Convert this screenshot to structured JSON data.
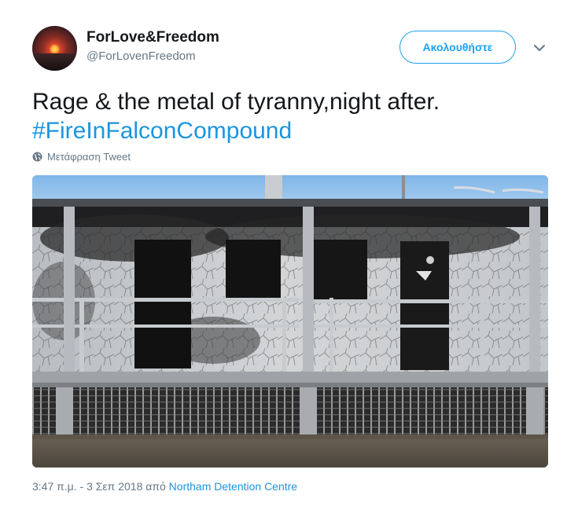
{
  "author": {
    "display_name": "ForLove&Freedom",
    "handle": "@ForLovenFreedom",
    "avatar_icon": "sunset-avatar"
  },
  "follow_button": {
    "label": "Ακολουθήστε"
  },
  "menu": {
    "icon": "chevron-down-icon"
  },
  "tweet": {
    "text": "Rage & the metal of tyranny,night after.",
    "hashtag": "#FireInFalconCompound"
  },
  "translate": {
    "label": "Μετάφραση Tweet",
    "icon": "globe-icon"
  },
  "media": {
    "icon": "photo-burned-building"
  },
  "footer": {
    "timestamp": "3:47 π.μ. - 3 Σεπ 2018 από",
    "source": "Northam Detention Centre"
  },
  "colors": {
    "accent": "#1da1f2",
    "link": "#1b95e0",
    "secondary_text": "#657786",
    "primary_text": "#14171a"
  }
}
